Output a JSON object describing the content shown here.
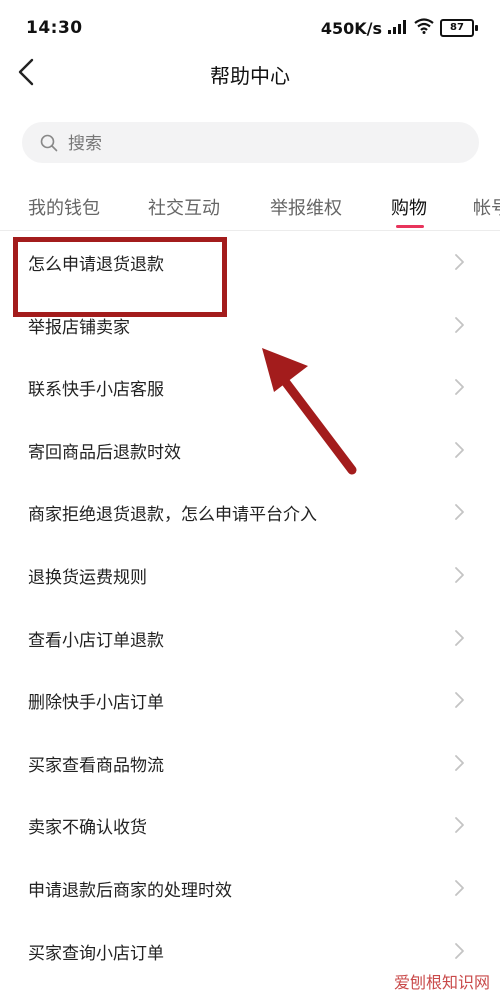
{
  "status_bar": {
    "time": "14:30",
    "network_speed": "450K/s",
    "battery": "87"
  },
  "header": {
    "title": "帮助中心"
  },
  "search": {
    "placeholder": "搜索"
  },
  "tabs": [
    {
      "label": "我的钱包",
      "active": false
    },
    {
      "label": "社交互动",
      "active": false
    },
    {
      "label": "举报维权",
      "active": false
    },
    {
      "label": "购物",
      "active": true
    },
    {
      "label": "帐号",
      "active": false
    }
  ],
  "items": [
    {
      "label": "怎么申请退货退款"
    },
    {
      "label": "举报店铺卖家"
    },
    {
      "label": "联系快手小店客服"
    },
    {
      "label": "寄回商品后退款时效"
    },
    {
      "label": "商家拒绝退货退款，怎么申请平台介入"
    },
    {
      "label": "退换货运费规则"
    },
    {
      "label": "查看小店订单退款"
    },
    {
      "label": "删除快手小店订单"
    },
    {
      "label": "买家查看商品物流"
    },
    {
      "label": "卖家不确认收货"
    },
    {
      "label": "申请退款后商家的处理时效"
    },
    {
      "label": "买家查询小店订单"
    }
  ],
  "watermark": "爱刨根知识网",
  "colors": {
    "accent": "#e8345b",
    "annotation": "#a31c1c"
  }
}
